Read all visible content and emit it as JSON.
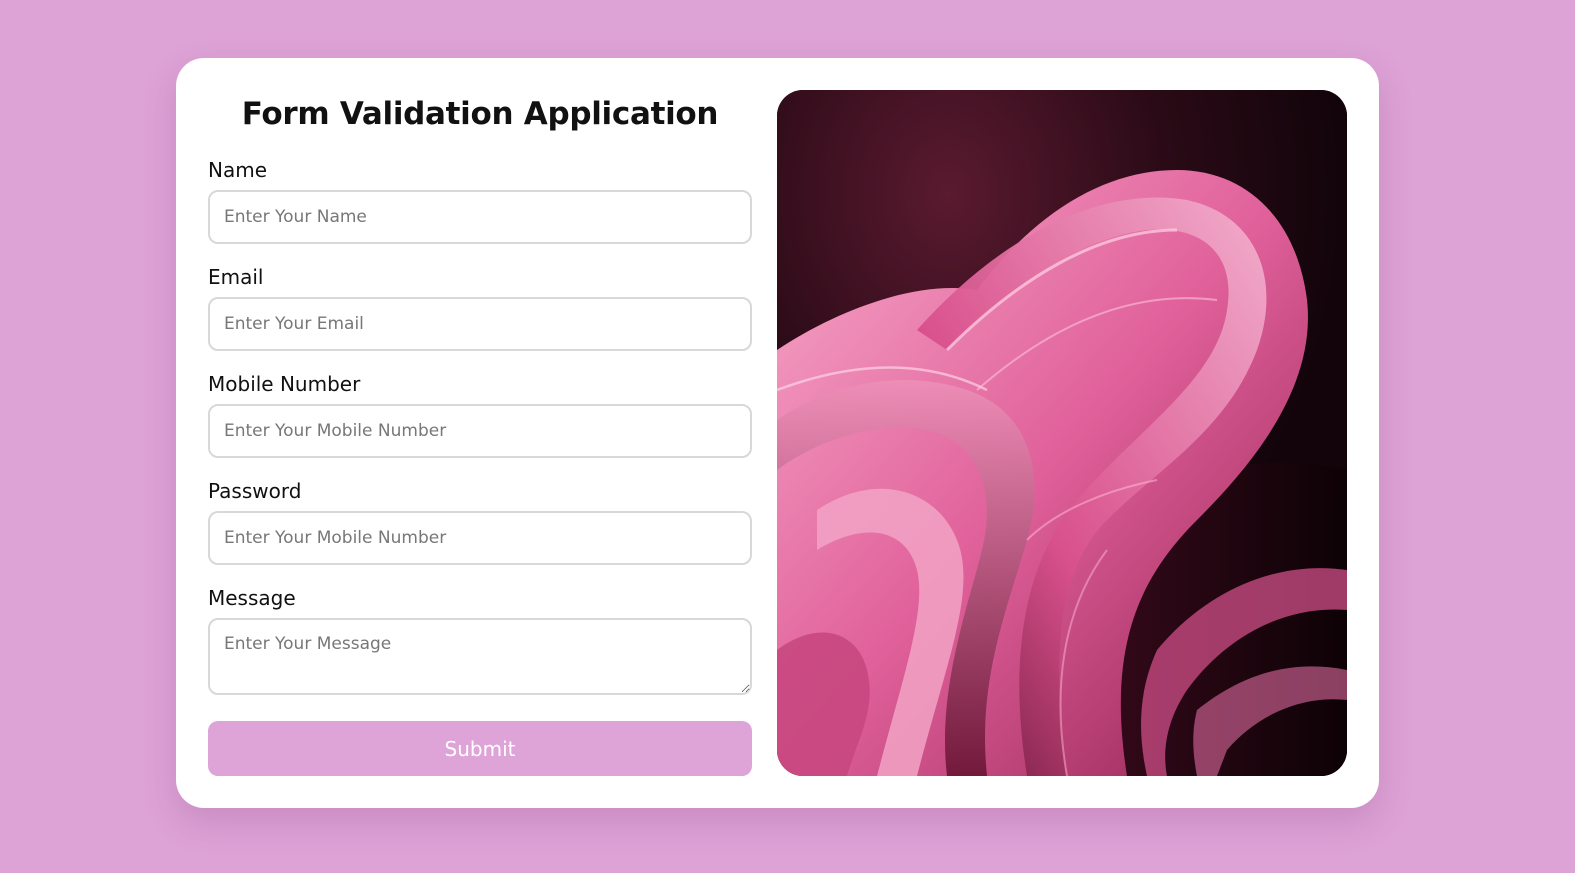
{
  "form": {
    "title": "Form Validation Application",
    "fields": {
      "name": {
        "label": "Name",
        "placeholder": "Enter Your Name"
      },
      "email": {
        "label": "Email",
        "placeholder": "Enter Your Email"
      },
      "mobile": {
        "label": "Mobile Number",
        "placeholder": "Enter Your Mobile Number"
      },
      "password": {
        "label": "Password",
        "placeholder": "Enter Your Mobile Number"
      },
      "message": {
        "label": "Message",
        "placeholder": "Enter Your Message"
      }
    },
    "submit_label": "Submit"
  },
  "colors": {
    "page_background": "#dda2d6",
    "card_background": "#ffffff",
    "submit_background": "#dea4d8",
    "image_dark": "#1a070d",
    "image_pink": "#e0609a"
  },
  "image": {
    "icon": "abstract-pink-ribbon-image"
  }
}
